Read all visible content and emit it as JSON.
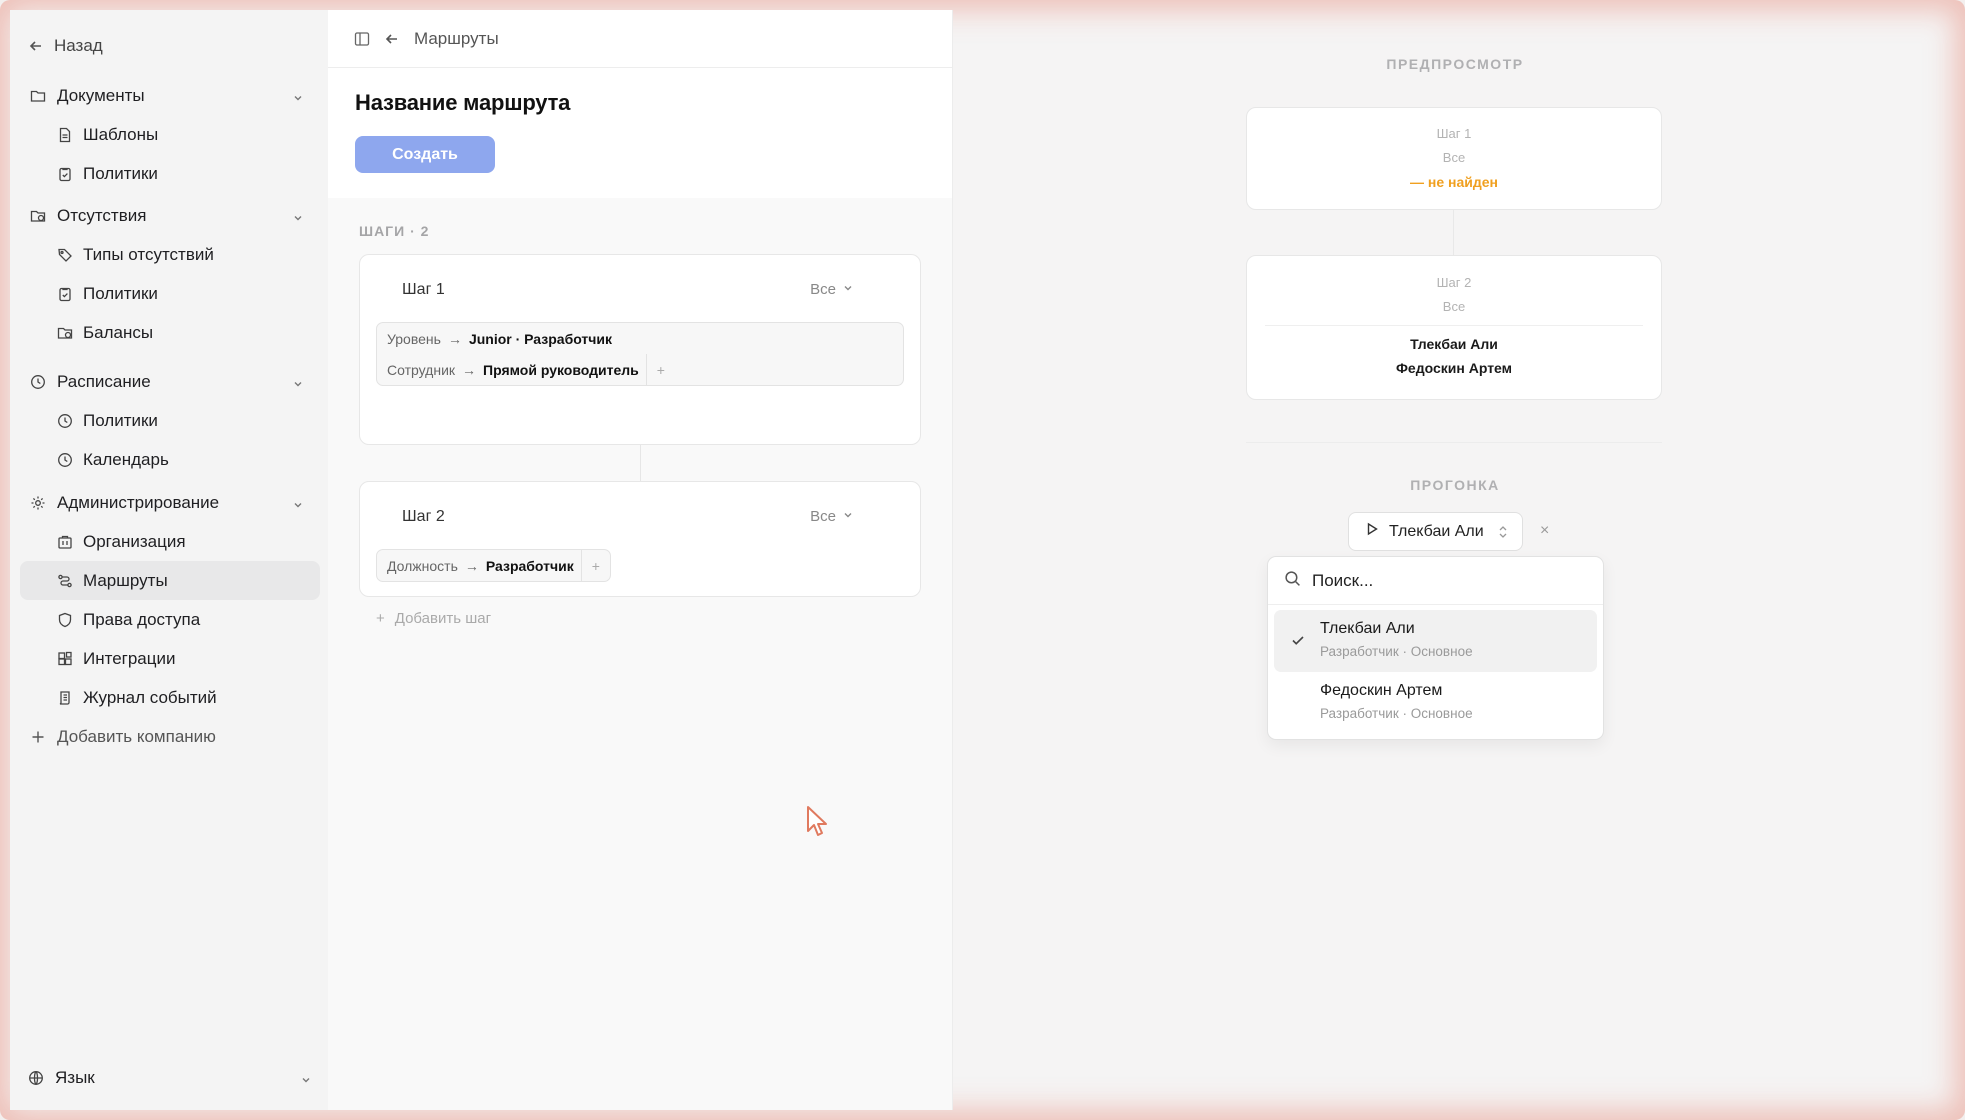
{
  "sidebar": {
    "back_label": "Назад",
    "groups": [
      {
        "label": "Документы",
        "icon": "folder-icon",
        "items": [
          {
            "label": "Шаблоны",
            "icon": "file-text-icon"
          },
          {
            "label": "Политики",
            "icon": "clipboard-check-icon"
          }
        ]
      },
      {
        "label": "Отсутствия",
        "icon": "folder-clock-icon",
        "items": [
          {
            "label": "Типы отсутствий",
            "icon": "tag-icon"
          },
          {
            "label": "Политики",
            "icon": "clipboard-check-icon"
          },
          {
            "label": "Балансы",
            "icon": "folder-clock-icon"
          }
        ]
      },
      {
        "label": "Расписание",
        "icon": "clock-icon",
        "items": [
          {
            "label": "Политики",
            "icon": "clock-icon"
          },
          {
            "label": "Календарь",
            "icon": "clock-icon"
          }
        ]
      },
      {
        "label": "Администрирование",
        "icon": "gear-icon",
        "items": [
          {
            "label": "Организация",
            "icon": "building-icon"
          },
          {
            "label": "Маршруты",
            "icon": "route-icon",
            "active": true
          },
          {
            "label": "Права доступа",
            "icon": "shield-icon"
          },
          {
            "label": "Интеграции",
            "icon": "blocks-icon"
          },
          {
            "label": "Журнал событий",
            "icon": "log-icon"
          }
        ]
      }
    ],
    "add_company": "Добавить компанию",
    "language": "Язык"
  },
  "topbar": {
    "breadcrumb": "Маршруты"
  },
  "editor": {
    "title": "Название маршрута",
    "create_label": "Создать",
    "steps_label": "ШАГИ · 2",
    "steps": [
      {
        "name": "Шаг 1",
        "mode": "Все",
        "rules": [
          {
            "field": "Уровень",
            "value": "Junior · Разработчик"
          },
          {
            "field": "Сотрудник",
            "value": "Прямой руководитель"
          }
        ]
      },
      {
        "name": "Шаг 2",
        "mode": "Все",
        "rules": [
          {
            "field": "Должность",
            "value": "Разработчик"
          }
        ]
      }
    ],
    "add_step": "Добавить шаг"
  },
  "preview": {
    "title": "ПРЕДПРОСМОТР",
    "cards": [
      {
        "step": "Шаг 1",
        "mode": "Все",
        "warning": "— не найден"
      },
      {
        "step": "Шаг 2",
        "mode": "Все",
        "names": [
          "Тлекбаи Али",
          "Федоскин Артем"
        ]
      }
    ]
  },
  "run": {
    "title": "ПРОГОНКА",
    "selected": "Тлекбаи Али",
    "clear": "×",
    "search_placeholder": "Поиск...",
    "options": [
      {
        "name": "Тлекбаи Али",
        "sub": "Разработчик · Основное",
        "selected": true
      },
      {
        "name": "Федоскин Артем",
        "sub": "Разработчик · Основное",
        "selected": false
      }
    ]
  },
  "colors": {
    "accent": "#8ea7ee",
    "warning": "#f0a020",
    "glow": "#e8968a"
  }
}
